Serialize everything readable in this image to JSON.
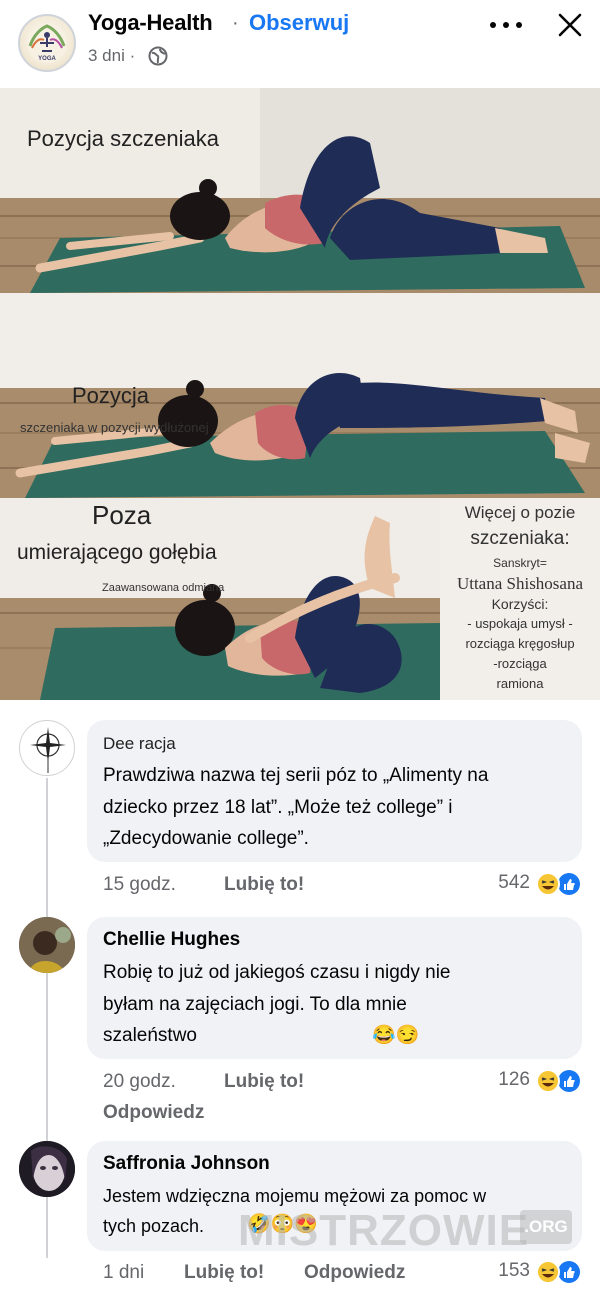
{
  "header": {
    "page_name": "Yoga-Health",
    "separator": "·",
    "follow_label": "Obserwuj",
    "time": "3 dni ·",
    "avatar_text": "YOGA"
  },
  "image": {
    "panel1_caption": "Pozycja szczeniaka",
    "panel2_caption_large": "Pozycja",
    "panel2_caption_small": "szczeniaka w pozycji wydłużonej",
    "panel3_caption_large": "Poza",
    "panel3_caption_mid": "umierającego gołębia",
    "panel3_caption_small": "Zaawansowana odmiana",
    "side_title_1": "Więcej o pozie",
    "side_title_2": "szczeniaka:",
    "side_sanskrit_label": "Sanskryt=",
    "side_sanskrit_name": "Uttana Shishosana",
    "side_benefits_label": "Korzyści:",
    "side_benefit_1": "- uspokaja umysł -",
    "side_benefit_2": "rozciąga kręgosłup",
    "side_benefit_3": "-rozciąga",
    "side_benefit_4": "ramiona"
  },
  "comments": [
    {
      "author": "Dee racja",
      "text_lines": [
        "Prawdziwa nazwa tej serii póz to „Alimenty na",
        "dziecko przez 18 lat”. „Może też college” i",
        "„Zdecydowanie college”."
      ],
      "time": "15 godz.",
      "like_label": "Lubię to!",
      "reaction_count": "542"
    },
    {
      "author": "Chellie Hughes",
      "text_lines": [
        "Robię to już od jakiegoś czasu i nigdy nie",
        "byłam na zajęciach jogi. To dla mnie",
        "szaleństwo"
      ],
      "emojis": "😂😏",
      "time": "20 godz.",
      "like_label": "Lubię to!",
      "reply_label": "Odpowiedz",
      "reaction_count": "126"
    },
    {
      "author": "Saffronia Johnson",
      "text_lines": [
        "Jestem wdzięczna mojemu mężowi za pomoc w",
        "tych pozach."
      ],
      "emojis": "🤣😳😍",
      "time": "1 dni",
      "like_label": "Lubię to!",
      "reply_label": "Odpowiedz",
      "reaction_count": "153"
    }
  ],
  "watermark": {
    "text": "MISTRZOWIE",
    "suffix": ".ORG"
  },
  "reaction_emojis": {
    "laugh": "😆",
    "like": "👍"
  },
  "colors": {
    "link_blue": "#1877f2",
    "bubble_gray": "#f0f2f5",
    "meta_gray": "#65676b",
    "mat_green": "#2f6b5e",
    "leggings_navy": "#1f2c56",
    "top_pink": "#c8686a"
  }
}
